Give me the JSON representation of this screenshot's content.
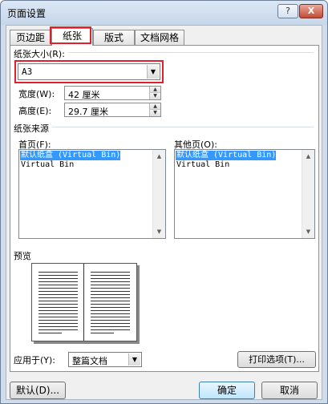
{
  "window": {
    "title": "页面设置",
    "help_glyph": "?",
    "close_glyph": "X"
  },
  "tabs": [
    {
      "label": "页边距",
      "active": false
    },
    {
      "label": "纸张",
      "active": true
    },
    {
      "label": "版式",
      "active": false
    },
    {
      "label": "文档网格",
      "active": false
    }
  ],
  "paper_size": {
    "label": "纸张大小(R):",
    "value": "A3",
    "arrow": "▼",
    "width_label": "宽度(W):",
    "width_value": "42 厘米",
    "height_label": "高度(E):",
    "height_value": "29.7 厘米"
  },
  "paper_source": {
    "label": "纸张来源",
    "first_page_label": "首页(F):",
    "other_pages_label": "其他页(O):",
    "first_page_items": [
      "默认纸盒 (Virtual Bin)",
      "Virtual Bin"
    ],
    "other_pages_items": [
      "默认纸盒 (Virtual Bin)",
      "Virtual Bin"
    ],
    "scroll_up": "▲",
    "scroll_down": "▼"
  },
  "preview": {
    "label": "预览"
  },
  "apply": {
    "label": "应用于(Y):",
    "value": "整篇文档",
    "arrow": "▼",
    "print_options_label": "打印选项(T)..."
  },
  "footer": {
    "default_label": "默认(D)...",
    "ok_label": "确定",
    "cancel_label": "取消"
  },
  "colors": {
    "highlight_red": "#e0202a",
    "selection_blue": "#3399ff"
  }
}
